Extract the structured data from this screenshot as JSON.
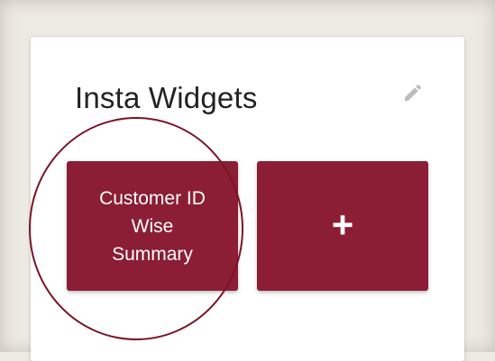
{
  "widget_panel": {
    "title": "Insta Widgets",
    "edit_icon": "pencil-icon",
    "tiles": [
      {
        "label": "Customer ID Wise Summary"
      },
      {
        "label": "+",
        "icon": "plus-icon"
      }
    ]
  },
  "colors": {
    "tile_background": "#8b1e34",
    "highlight_circle": "#7a1426",
    "page_background": "#ede9e3",
    "card_background": "#ffffff"
  }
}
